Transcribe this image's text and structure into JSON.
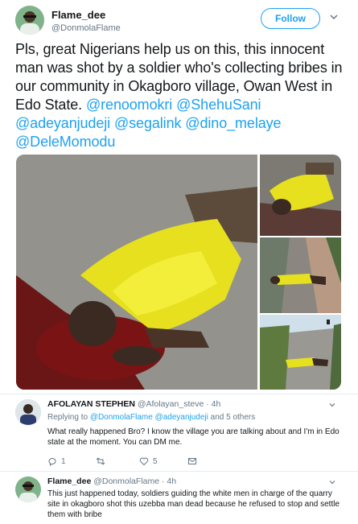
{
  "tweet": {
    "name": "Flame_dee",
    "handle": "@DonmolaFlame",
    "follow_label": "Follow",
    "text_plain": "Pls, great Nigerians help us on this, this innocent man was shot by a soldier who's collecting bribes in our community in Okagboro village, Owan West in Edo State.",
    "mentions": [
      "@renoomokri",
      "@ShehuSani",
      "@adeyanjudeji",
      "@segalink",
      "@dino_melaye",
      "@DeleMomodu"
    ]
  },
  "replies": [
    {
      "name": "AFOLAYAN STEPHEN",
      "handle": "@Afolayan_steve",
      "time": "· 4h",
      "replying_prefix": "Replying to",
      "replying_to_1": "@DonmolaFlame",
      "replying_to_2": "@adeyanjudeji",
      "replying_suffix": "and 5 others",
      "text": "What really happened Bro? I know the village you are talking about and I'm in Edo state at the moment. You can DM me.",
      "reply_count": "1",
      "retweet_count": "",
      "like_count": "5"
    },
    {
      "name": "Flame_dee",
      "handle": "@DonmolaFlame",
      "time": "· 4h",
      "text": "This just happened today, soldiers guiding the white men in charge of the quarry site in okagboro shot this uzebba man dead because he refused to stop and settle them with bribe"
    }
  ],
  "colors": {
    "accent": "#1da1f2",
    "secondary_text": "#657786",
    "divider": "#e6ecf0"
  },
  "icons": [
    "chevron-down-icon",
    "reply-icon",
    "retweet-icon",
    "like-icon",
    "message-icon"
  ]
}
